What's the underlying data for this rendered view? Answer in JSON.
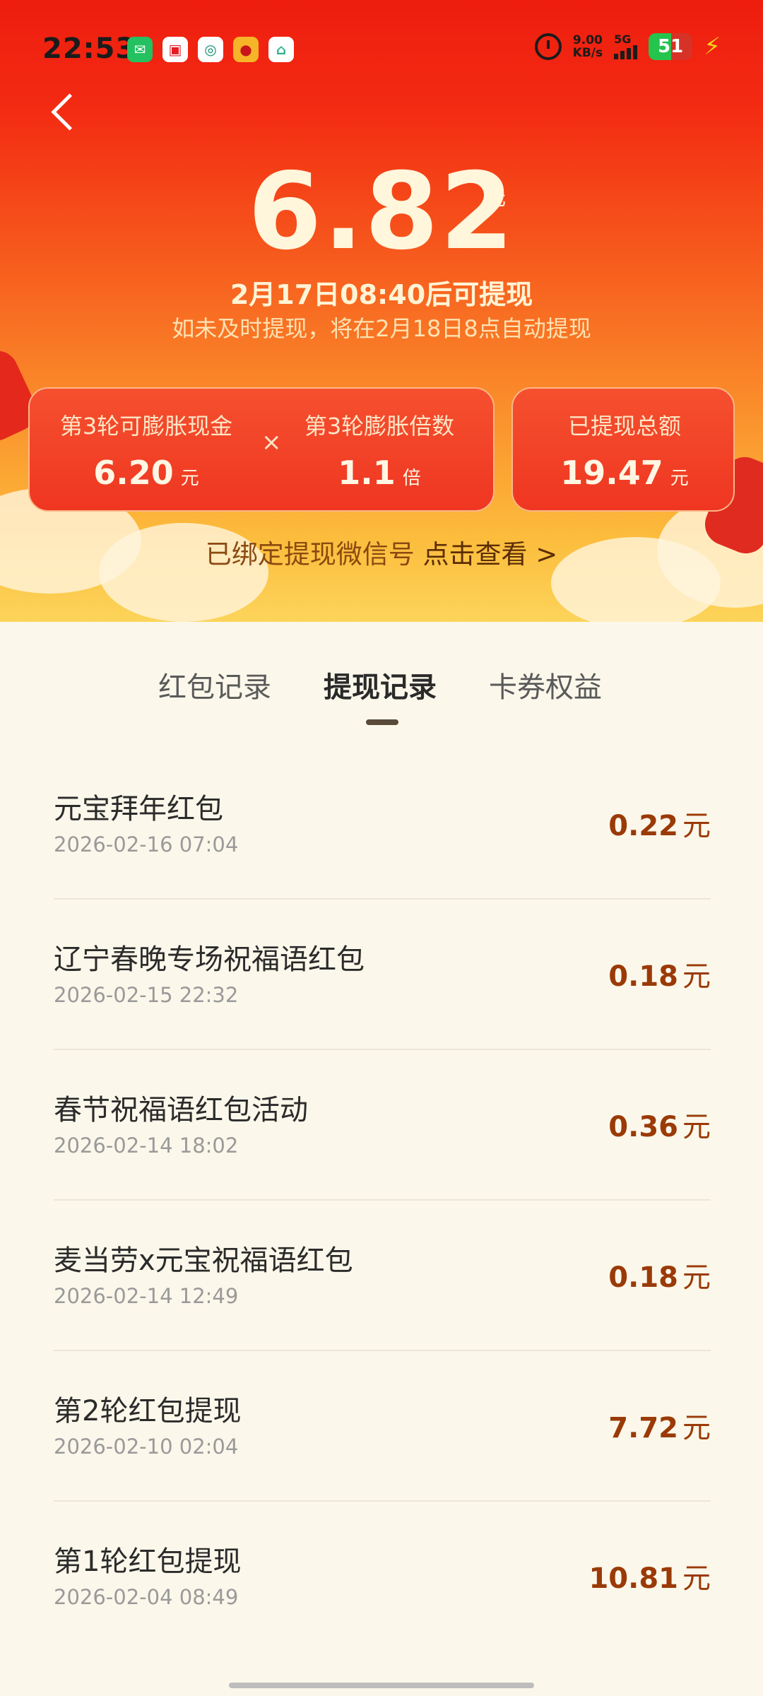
{
  "status_bar": {
    "time": "22:53",
    "net_speed_value": "9.00",
    "net_speed_unit": "KB/s",
    "network": "5G",
    "battery": "51",
    "battery_level": 0.51,
    "app_icons": [
      "wechat-icon",
      "shop-icon",
      "bank-icon",
      "weibo-icon",
      "home-app-icon"
    ]
  },
  "header": {
    "amount": "6.82",
    "amount_unit": "元",
    "available_time": "2月17日08:40后可提现",
    "auto_note": "如未及时提现，将在2月18日8点自动提现"
  },
  "cards": {
    "inflatable_label": "第3轮可膨胀现金",
    "inflatable_value": "6.20",
    "inflatable_unit": "元",
    "times_sign": "×",
    "multiplier_label": "第3轮膨胀倍数",
    "multiplier_value": "1.1",
    "multiplier_unit": "倍",
    "withdrawn_label": "已提现总额",
    "withdrawn_value": "19.47",
    "withdrawn_unit": "元"
  },
  "bind": {
    "text": "已绑定提现微信号",
    "link": "点击查看 >"
  },
  "tabs": [
    "红包记录",
    "提现记录",
    "卡券权益"
  ],
  "active_tab": "提现记录",
  "records": [
    {
      "title": "元宝拜年红包",
      "date": "2026-02-16 07:04",
      "amount": "0.22",
      "unit": "元"
    },
    {
      "title": "辽宁春晚专场祝福语红包",
      "date": "2026-02-15 22:32",
      "amount": "0.18",
      "unit": "元"
    },
    {
      "title": "春节祝福语红包活动",
      "date": "2026-02-14 18:02",
      "amount": "0.36",
      "unit": "元"
    },
    {
      "title": "麦当劳x元宝祝福语红包",
      "date": "2026-02-14 12:49",
      "amount": "0.18",
      "unit": "元"
    },
    {
      "title": "第2轮红包提现",
      "date": "2026-02-10 02:04",
      "amount": "7.72",
      "unit": "元"
    },
    {
      "title": "第1轮红包提现",
      "date": "2026-02-04 08:49",
      "amount": "10.81",
      "unit": "元"
    }
  ],
  "colors": {
    "header_red": "#ee1d0f",
    "header_gold": "#fcd45a",
    "amount_brown": "#9a3a07",
    "page_bg": "#fbf7ea"
  }
}
